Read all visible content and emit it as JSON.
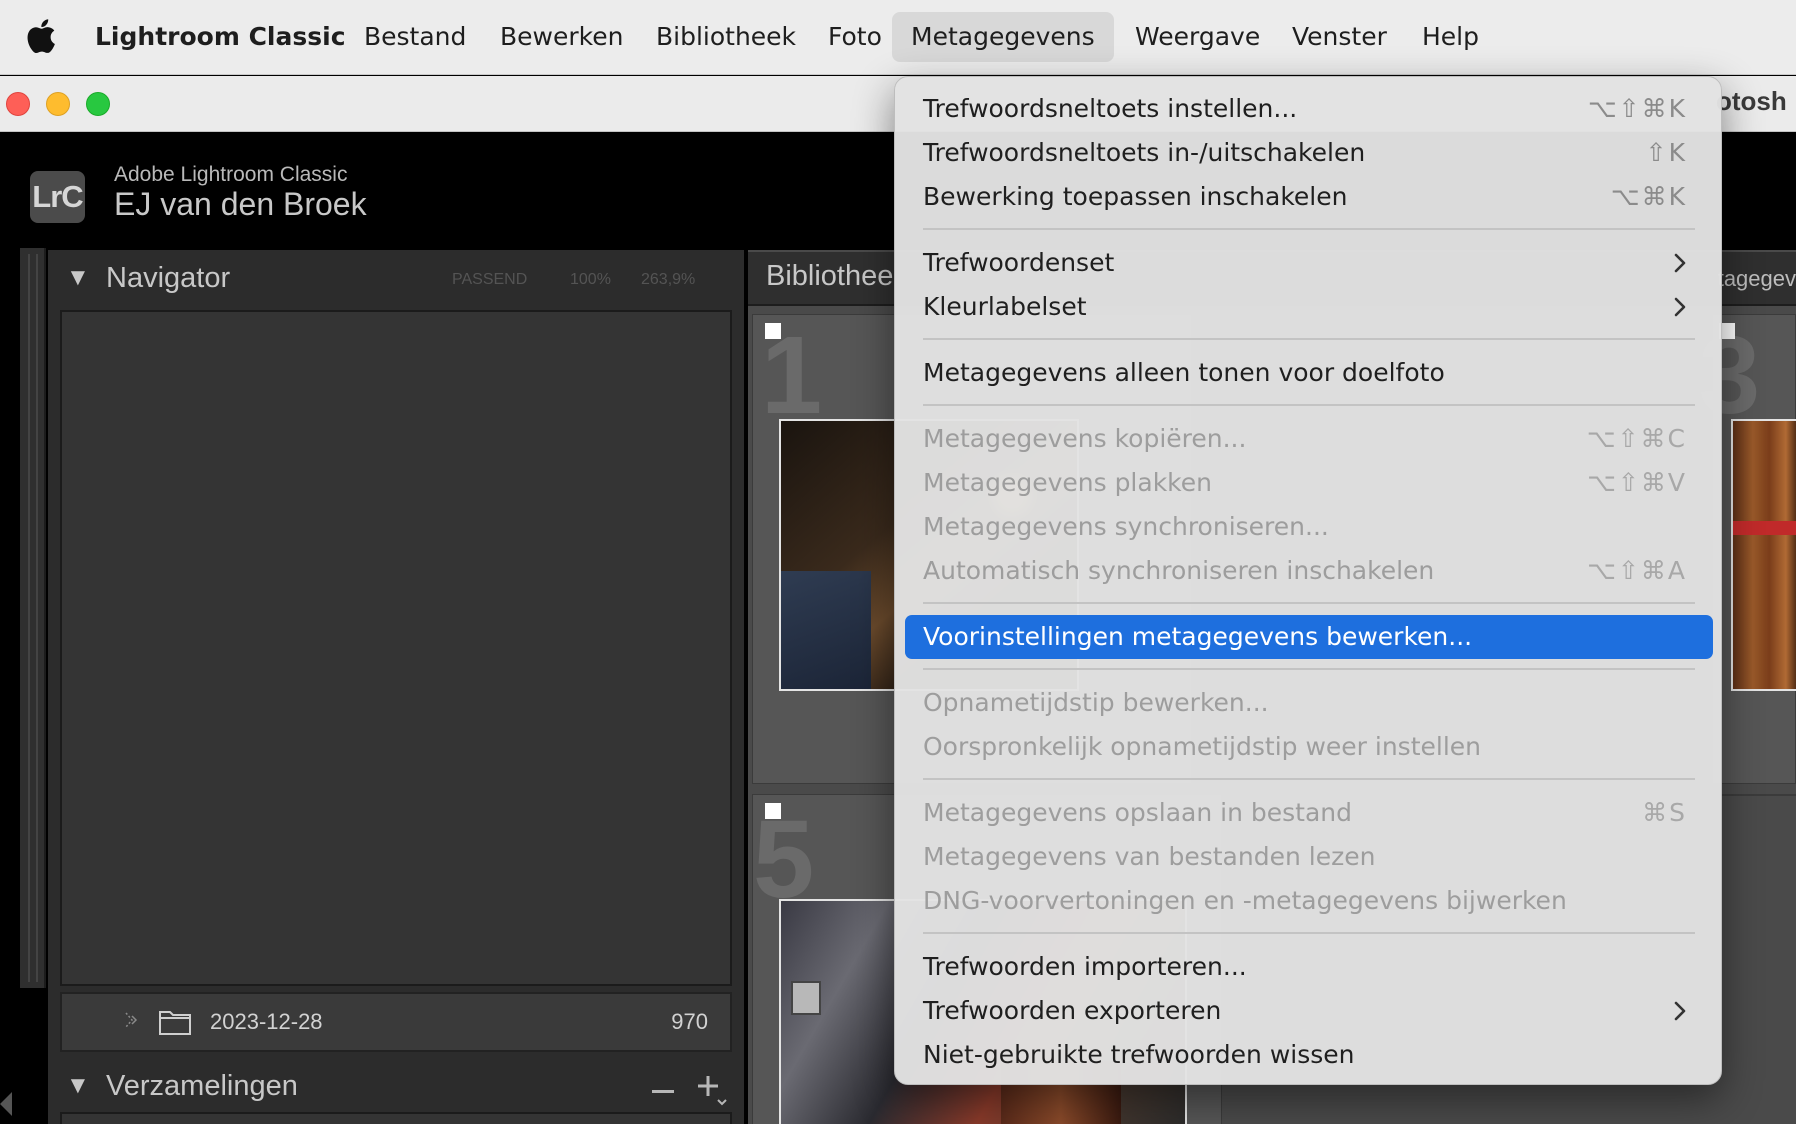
{
  "menubar": {
    "app_name": "Lightroom Classic",
    "items": [
      {
        "label": "Bestand"
      },
      {
        "label": "Bewerken"
      },
      {
        "label": "Bibliotheek"
      },
      {
        "label": "Foto"
      },
      {
        "label": "Metagegevens"
      },
      {
        "label": "Weergave"
      },
      {
        "label": "Venster"
      },
      {
        "label": "Help"
      }
    ]
  },
  "window": {
    "title_fragment": "otosh"
  },
  "identity": {
    "logo": "LrC",
    "product": "Adobe Lightroom Classic",
    "user": "EJ van den Broek"
  },
  "navigator": {
    "title": "Navigator",
    "options": [
      "PASSEND",
      "100%",
      "263,9%"
    ]
  },
  "folder": {
    "name": "2023-12-28",
    "count": "970"
  },
  "collections": {
    "title": "Verzamelingen"
  },
  "grid": {
    "title": "Bibliothee",
    "right_fragment": "tagegev",
    "cell_numbers": [
      "1",
      "3",
      "5"
    ]
  },
  "menu": {
    "items": [
      {
        "label": "Trefwoordsneltoets instellen...",
        "shortcut": "⌥⇧⌘K"
      },
      {
        "label": "Trefwoordsneltoets in-/uitschakelen",
        "shortcut": "⇧K"
      },
      {
        "label": "Bewerking toepassen inschakelen",
        "shortcut": "⌥⌘K"
      },
      {
        "label": "Trefwoordenset"
      },
      {
        "label": "Kleurlabelset"
      },
      {
        "label": "Metagegevens alleen tonen voor doelfoto"
      },
      {
        "label": "Metagegevens kopiëren...",
        "shortcut": "⌥⇧⌘C"
      },
      {
        "label": "Metagegevens plakken",
        "shortcut": "⌥⇧⌘V"
      },
      {
        "label": "Metagegevens synchroniseren..."
      },
      {
        "label": "Automatisch synchroniseren inschakelen",
        "shortcut": "⌥⇧⌘A"
      },
      {
        "label": "Voorinstellingen metagegevens bewerken..."
      },
      {
        "label": "Opnametijdstip bewerken..."
      },
      {
        "label": "Oorspronkelijk opnametijdstip weer instellen"
      },
      {
        "label": "Metagegevens opslaan in bestand",
        "shortcut": "⌘S"
      },
      {
        "label": "Metagegevens van bestanden lezen"
      },
      {
        "label": "DNG-voorvertoningen en -metagegevens bijwerken"
      },
      {
        "label": "Trefwoorden importeren..."
      },
      {
        "label": "Trefwoorden exporteren"
      },
      {
        "label": "Niet-gebruikte trefwoorden wissen"
      }
    ]
  },
  "colors": {
    "highlight": "#1e6fde",
    "lr_background": "#000000",
    "panel": "#2c2c2c"
  }
}
